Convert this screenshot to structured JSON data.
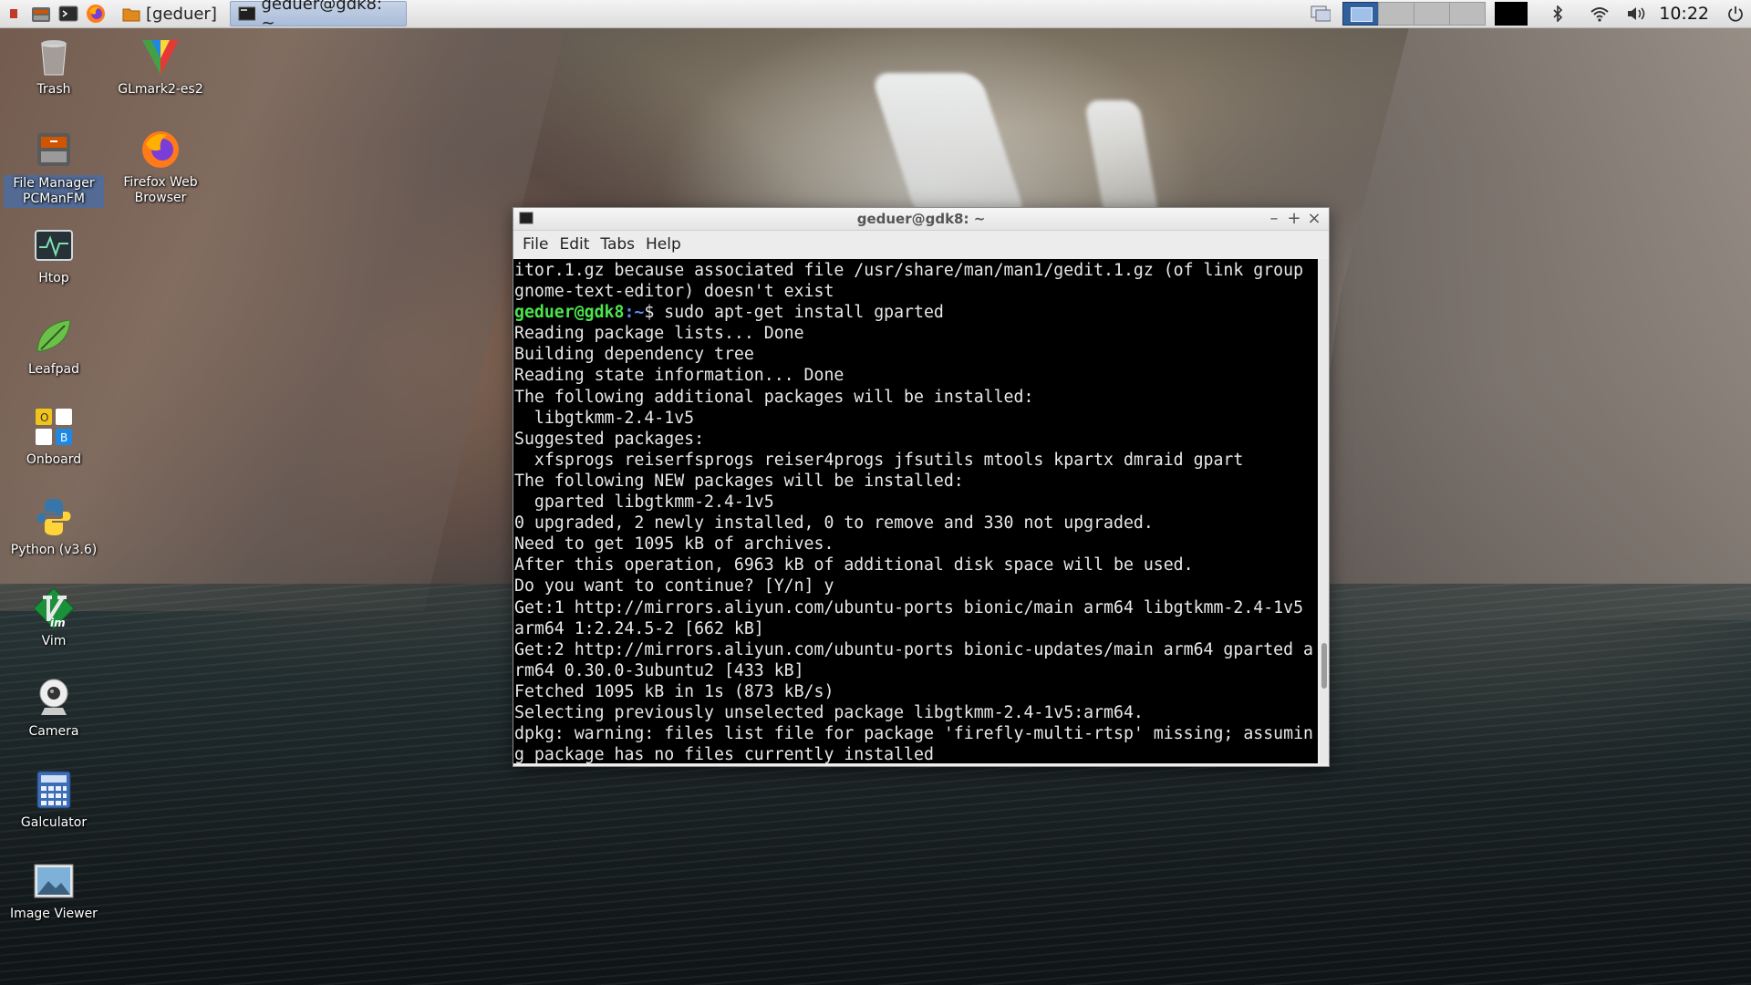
{
  "panel": {
    "launchers": [
      "app-menu-icon",
      "file-manager-icon",
      "terminal-icon",
      "firefox-icon"
    ],
    "tasks": [
      {
        "label": "[geduer]",
        "icon": "folder-icon",
        "active": false
      },
      {
        "label": "geduer@gdk8: ~",
        "icon": "terminal-icon",
        "active": true
      }
    ],
    "clock": "10:22",
    "colors": {
      "accent": "#2f5f9c",
      "panel_bg": "#e4e4e4"
    }
  },
  "desktop": {
    "icons": [
      {
        "label": "Trash",
        "icon": "trash-icon"
      },
      {
        "label": "GLmark2-es2",
        "icon": "glmark-icon"
      },
      {
        "label": "File Manager\nPCManFM",
        "icon": "file-manager-icon",
        "selected": true
      },
      {
        "label": "Firefox Web\nBrowser",
        "icon": "firefox-icon"
      },
      {
        "label": "Htop",
        "icon": "htop-icon"
      },
      {
        "label": "Leafpad",
        "icon": "leafpad-icon"
      },
      {
        "label": "Onboard",
        "icon": "onboard-icon"
      },
      {
        "label": "Python (v3.6)",
        "icon": "python-icon"
      },
      {
        "label": "Vim",
        "icon": "vim-icon"
      },
      {
        "label": "Camera",
        "icon": "camera-icon"
      },
      {
        "label": "Galculator",
        "icon": "calculator-icon"
      },
      {
        "label": "Image Viewer",
        "icon": "image-viewer-icon"
      }
    ]
  },
  "terminal": {
    "title": "geduer@gdk8: ~",
    "menu": [
      "File",
      "Edit",
      "Tabs",
      "Help"
    ],
    "prompt_user": "geduer@gdk8",
    "prompt_path": ":~",
    "prompt_cmd": "$ sudo apt-get install gparted",
    "lines_before": [
      "itor.1.gz because associated file /usr/share/man/man1/gedit.1.gz (of link group",
      "gnome-text-editor) doesn't exist"
    ],
    "lines_after": [
      "Reading package lists... Done",
      "Building dependency tree",
      "Reading state information... Done",
      "The following additional packages will be installed:",
      "  libgtkmm-2.4-1v5",
      "Suggested packages:",
      "  xfsprogs reiserfsprogs reiser4progs jfsutils mtools kpartx dmraid gpart",
      "The following NEW packages will be installed:",
      "  gparted libgtkmm-2.4-1v5",
      "0 upgraded, 2 newly installed, 0 to remove and 330 not upgraded.",
      "Need to get 1095 kB of archives.",
      "After this operation, 6963 kB of additional disk space will be used.",
      "Do you want to continue? [Y/n] y",
      "Get:1 http://mirrors.aliyun.com/ubuntu-ports bionic/main arm64 libgtkmm-2.4-1v5",
      "arm64 1:2.24.5-2 [662 kB]",
      "Get:2 http://mirrors.aliyun.com/ubuntu-ports bionic-updates/main arm64 gparted a",
      "rm64 0.30.0-3ubuntu2 [433 kB]",
      "Fetched 1095 kB in 1s (873 kB/s)",
      "Selecting previously unselected package libgtkmm-2.4-1v5:arm64.",
      "dpkg: warning: files list file for package 'firefly-multi-rtsp' missing; assumin",
      "g package has no files currently installed"
    ],
    "colors": {
      "prompt_user": "#4ee34e",
      "prompt_path": "#5d8df0",
      "bg": "#000000",
      "fg": "#e8e8e8"
    }
  }
}
